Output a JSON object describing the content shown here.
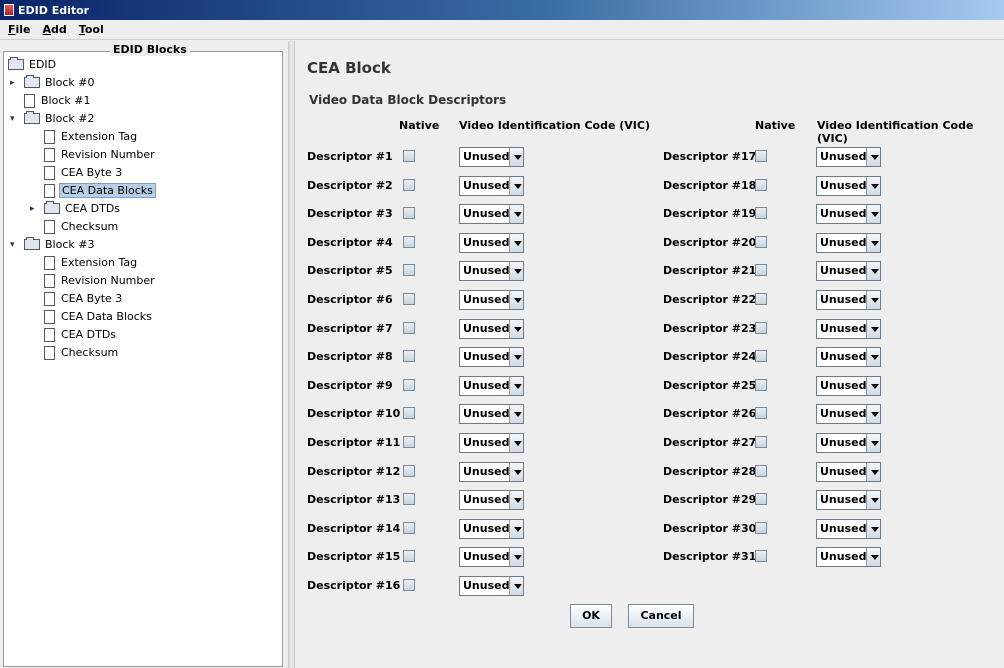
{
  "window": {
    "title": "EDID Editor"
  },
  "menu": [
    {
      "mnemonic": "F",
      "rest": "ile"
    },
    {
      "mnemonic": "A",
      "rest": "dd"
    },
    {
      "mnemonic": "T",
      "rest": "ool"
    }
  ],
  "tree": {
    "legend": "EDID Blocks",
    "root": "EDID",
    "nodes": [
      {
        "label": "Block #0",
        "type": "folder",
        "depth": 1,
        "handle": "collapsed"
      },
      {
        "label": "Block #1",
        "type": "leaf",
        "depth": 1
      },
      {
        "label": "Block #2",
        "type": "folder",
        "depth": 1,
        "handle": "expanded"
      },
      {
        "label": "Extension Tag",
        "type": "leaf",
        "depth": 2
      },
      {
        "label": "Revision Number",
        "type": "leaf",
        "depth": 2
      },
      {
        "label": "CEA Byte 3",
        "type": "leaf",
        "depth": 2
      },
      {
        "label": "CEA Data Blocks",
        "type": "leaf",
        "depth": 2,
        "selected": true
      },
      {
        "label": "CEA DTDs",
        "type": "folder",
        "depth": 2,
        "handle": "collapsed"
      },
      {
        "label": "Checksum",
        "type": "leaf",
        "depth": 2
      },
      {
        "label": "Block #3",
        "type": "folder",
        "depth": 1,
        "handle": "expanded"
      },
      {
        "label": "Extension Tag",
        "type": "leaf",
        "depth": 2
      },
      {
        "label": "Revision Number",
        "type": "leaf",
        "depth": 2
      },
      {
        "label": "CEA Byte 3",
        "type": "leaf",
        "depth": 2
      },
      {
        "label": "CEA Data Blocks",
        "type": "leaf",
        "depth": 2
      },
      {
        "label": "CEA DTDs",
        "type": "leaf",
        "depth": 2
      },
      {
        "label": "Checksum",
        "type": "leaf",
        "depth": 2
      }
    ]
  },
  "main": {
    "title": "CEA Block",
    "section_title": "Video Data Block Descriptors",
    "headers": {
      "native": "Native",
      "vic": "Video Identification Code (VIC)"
    },
    "descriptors": [
      {
        "label": "Descriptor #1",
        "native": false,
        "vic": "Unused"
      },
      {
        "label": "Descriptor #2",
        "native": false,
        "vic": "Unused"
      },
      {
        "label": "Descriptor #3",
        "native": false,
        "vic": "Unused"
      },
      {
        "label": "Descriptor #4",
        "native": false,
        "vic": "Unused"
      },
      {
        "label": "Descriptor #5",
        "native": false,
        "vic": "Unused"
      },
      {
        "label": "Descriptor #6",
        "native": false,
        "vic": "Unused"
      },
      {
        "label": "Descriptor #7",
        "native": false,
        "vic": "Unused"
      },
      {
        "label": "Descriptor #8",
        "native": false,
        "vic": "Unused"
      },
      {
        "label": "Descriptor #9",
        "native": false,
        "vic": "Unused"
      },
      {
        "label": "Descriptor #10",
        "native": false,
        "vic": "Unused"
      },
      {
        "label": "Descriptor #11",
        "native": false,
        "vic": "Unused"
      },
      {
        "label": "Descriptor #12",
        "native": false,
        "vic": "Unused"
      },
      {
        "label": "Descriptor #13",
        "native": false,
        "vic": "Unused"
      },
      {
        "label": "Descriptor #14",
        "native": false,
        "vic": "Unused"
      },
      {
        "label": "Descriptor #15",
        "native": false,
        "vic": "Unused"
      },
      {
        "label": "Descriptor #16",
        "native": false,
        "vic": "Unused"
      },
      {
        "label": "Descriptor #17",
        "native": false,
        "vic": "Unused"
      },
      {
        "label": "Descriptor #18",
        "native": false,
        "vic": "Unused"
      },
      {
        "label": "Descriptor #19",
        "native": false,
        "vic": "Unused"
      },
      {
        "label": "Descriptor #20",
        "native": false,
        "vic": "Unused"
      },
      {
        "label": "Descriptor #21",
        "native": false,
        "vic": "Unused"
      },
      {
        "label": "Descriptor #22",
        "native": false,
        "vic": "Unused"
      },
      {
        "label": "Descriptor #23",
        "native": false,
        "vic": "Unused"
      },
      {
        "label": "Descriptor #24",
        "native": false,
        "vic": "Unused"
      },
      {
        "label": "Descriptor #25",
        "native": false,
        "vic": "Unused"
      },
      {
        "label": "Descriptor #26",
        "native": false,
        "vic": "Unused"
      },
      {
        "label": "Descriptor #27",
        "native": false,
        "vic": "Unused"
      },
      {
        "label": "Descriptor #28",
        "native": false,
        "vic": "Unused"
      },
      {
        "label": "Descriptor #29",
        "native": false,
        "vic": "Unused"
      },
      {
        "label": "Descriptor #30",
        "native": false,
        "vic": "Unused"
      },
      {
        "label": "Descriptor #31",
        "native": false,
        "vic": "Unused"
      }
    ],
    "ok_label": "OK",
    "cancel_label": "Cancel"
  }
}
